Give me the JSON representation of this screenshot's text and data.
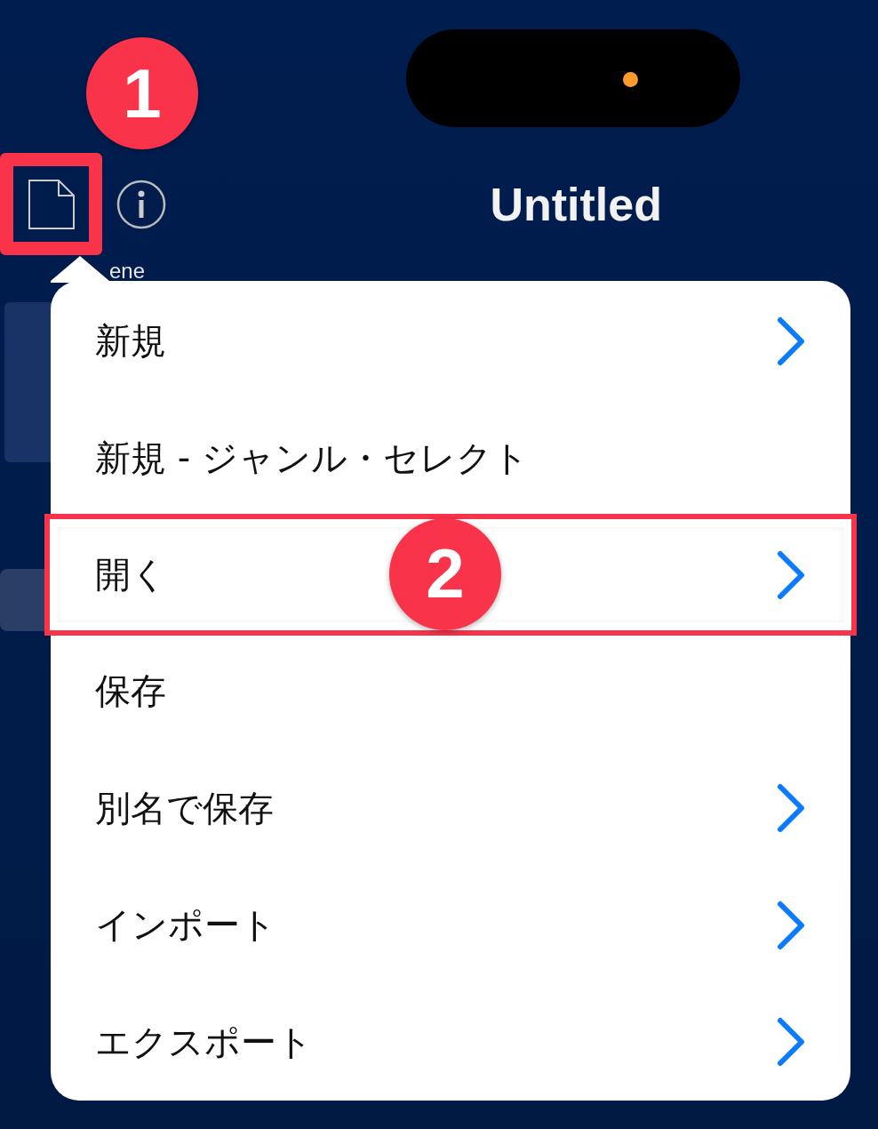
{
  "header": {
    "title": "Untitled",
    "file_button": {
      "annotated": true,
      "badge": "1"
    }
  },
  "background_label": "ene",
  "menu": {
    "items": [
      {
        "label": "新規",
        "has_submenu": true,
        "annotated": false
      },
      {
        "label": "新規 - ジャンル・セレクト",
        "has_submenu": false,
        "annotated": false
      },
      {
        "label": "開く",
        "has_submenu": true,
        "annotated": true,
        "badge": "2"
      },
      {
        "label": "保存",
        "has_submenu": false,
        "annotated": false
      },
      {
        "label": "別名で保存",
        "has_submenu": true,
        "annotated": false
      },
      {
        "label": "インポート",
        "has_submenu": true,
        "annotated": false
      },
      {
        "label": "エクスポート",
        "has_submenu": true,
        "annotated": false
      }
    ]
  }
}
